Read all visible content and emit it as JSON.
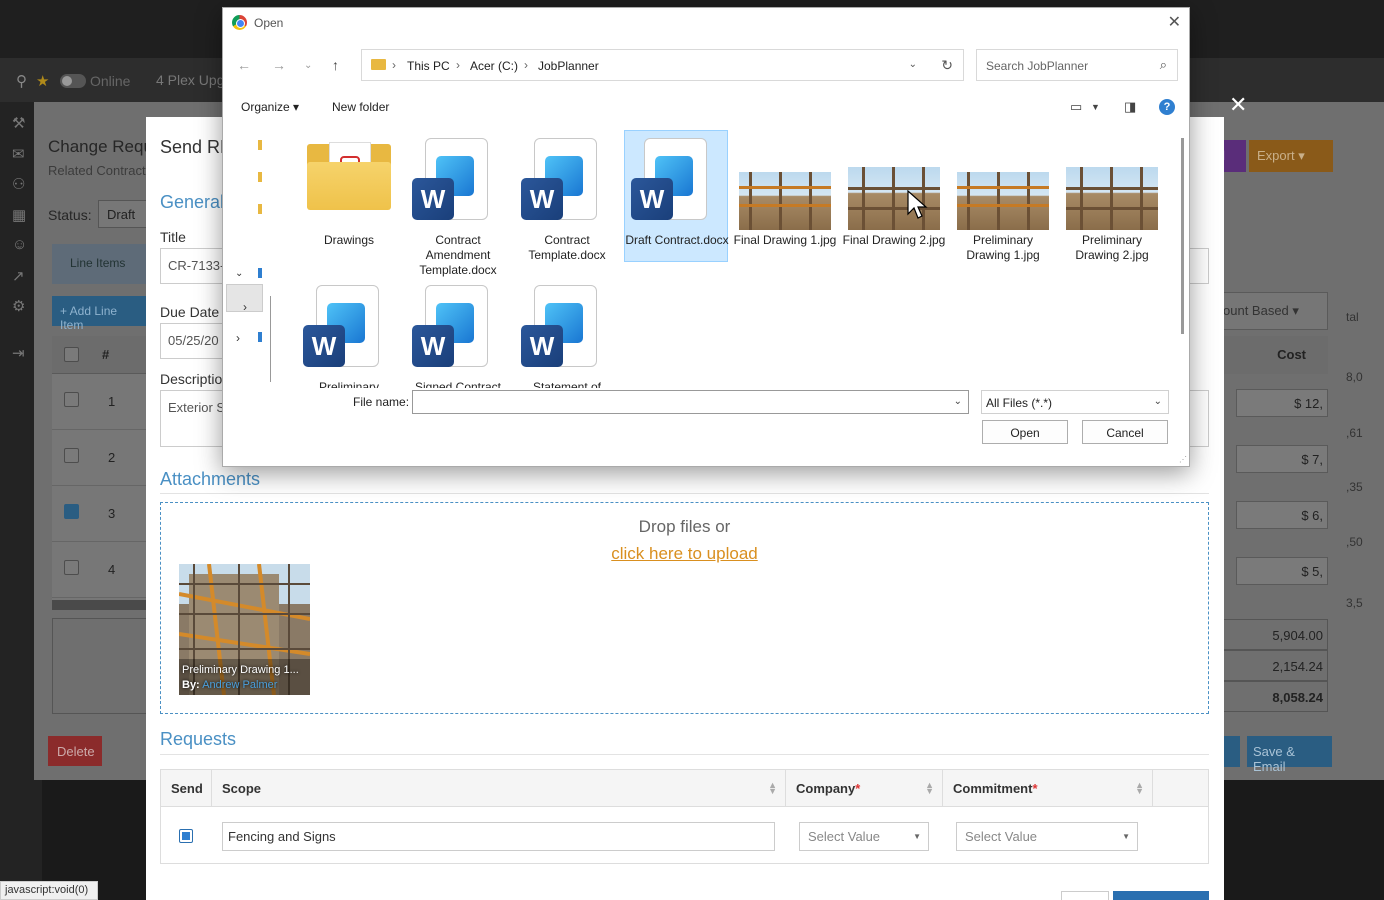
{
  "app": {
    "online_label": "Online",
    "project_name": "4 Plex Upg",
    "change_request_title": "Change Requ",
    "change_request_subtitle": "Related Contract",
    "status_label": "Status:",
    "status_value": "Draft",
    "info_tab": "Line Items",
    "add_line_button": "+ Add Line Item",
    "table_hash": "#",
    "row_numbers": [
      "1",
      "2",
      "3",
      "4"
    ],
    "row3_checked": true,
    "delete_button": "Delete",
    "email_button_partial": "ail",
    "export_button": "Export",
    "account_select": "ount Based",
    "cost_header": "Cost",
    "costs": [
      "$ 12,",
      "$ 7,",
      "$ 6,",
      "$ 5,"
    ],
    "right_cut": [
      "8,0",
      ",61",
      ",35",
      ",50",
      "3,5"
    ],
    "sums": [
      "5,904.00",
      "2,154.24",
      "8,058.24"
    ],
    "save_partial": "ve",
    "save_email_button": "Save & Email",
    "tal_label": "tal"
  },
  "modal": {
    "title": "Send RF",
    "general_heading": "General",
    "title_label": "Title",
    "title_value": "CR-7133-",
    "due_date_label": "Due Date *",
    "due_date_value": "05/25/20",
    "description_label": "Descriptio",
    "description_value": "Exterior S",
    "attachments_heading": "Attachments",
    "drop_text": "Drop files or",
    "upload_link": "click here to upload",
    "thumb_caption": "Preliminary Drawing 1...",
    "thumb_by_label": "By:",
    "thumb_by_name": "Andrew Palmer",
    "requests_heading": "Requests",
    "columns": {
      "send": "Send",
      "scope": "Scope",
      "company": "Company",
      "commitment": "Commitment",
      "required_marker": "*"
    },
    "row": {
      "send_checked": true,
      "scope_value": "Fencing and Signs",
      "company_placeholder": "Select Value",
      "commitment_placeholder": "Select Value"
    }
  },
  "dialog": {
    "title": "Open",
    "breadcrumb": [
      "This PC",
      "Acer (C:)",
      "JobPlanner"
    ],
    "search_placeholder": "Search JobPlanner",
    "organize_label": "Organize",
    "new_folder_label": "New folder",
    "help_label": "?",
    "files_row1": [
      {
        "name": "Drawings",
        "kind": "folder"
      },
      {
        "name": "Contract Amendment Template.docx",
        "kind": "docx"
      },
      {
        "name": "Contract Template.docx",
        "kind": "docx"
      },
      {
        "name": "Draft Contract.docx",
        "kind": "docx",
        "selected": true
      },
      {
        "name": "Final Drawing 1.jpg",
        "kind": "jpg"
      },
      {
        "name": "Final Drawing 2.jpg",
        "kind": "jpg"
      },
      {
        "name": "Preliminary Drawing 1.jpg",
        "kind": "jpg"
      },
      {
        "name": "Preliminary Drawing 2.jpg",
        "kind": "jpg"
      }
    ],
    "files_row2": [
      {
        "name": "Preliminary",
        "kind": "docx"
      },
      {
        "name": "Signed Contract",
        "kind": "docx"
      },
      {
        "name": "Statement of",
        "kind": "docx"
      }
    ],
    "file_name_label": "File name:",
    "file_name_value": "",
    "file_type": "All Files (*.*)",
    "open_button": "Open",
    "cancel_button": "Cancel"
  },
  "status_bar_text": "javascript:void(0)"
}
